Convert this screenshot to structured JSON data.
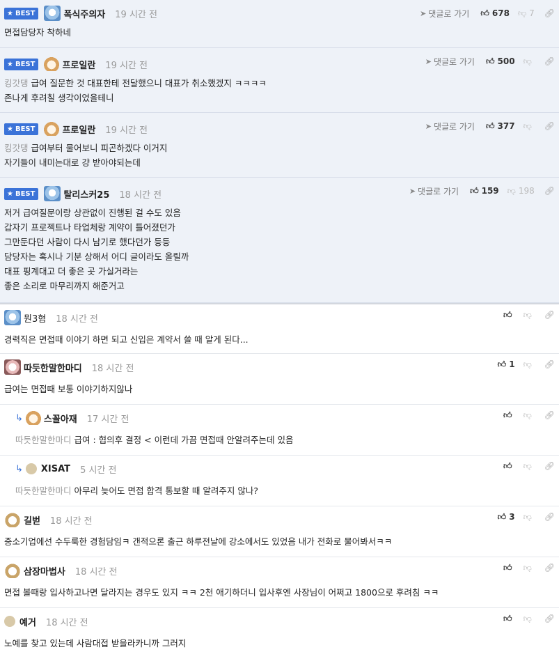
{
  "labels": {
    "best": "BEST",
    "goto": "댓글로 가기"
  },
  "comments": [
    {
      "nick": "폭식주의자",
      "time": "19 시간 전",
      "up": "678",
      "down": "7",
      "lines": [
        "면접담당자 착하네"
      ]
    },
    {
      "nick": "프로일란",
      "time": "19 시간 전",
      "up": "500",
      "down": "",
      "mention": "킹갓댕",
      "lines": [
        "급여 질문한 것 대표한테 전달했으니 대표가 취소했겠지 ㅋㅋㅋㅋ",
        "존나게 후려칠 생각이었을테니"
      ]
    },
    {
      "nick": "프로일란",
      "time": "19 시간 전",
      "up": "377",
      "down": "",
      "mention": "킹갓댕",
      "lines": [
        "급여부터 물어보니 피곤하겠다 이거지",
        "자기들이 내미는대로 걍 받아야되는데"
      ]
    },
    {
      "nick": "탈리스커25",
      "time": "18 시간 전",
      "up": "159",
      "down": "198",
      "lines": [
        "저거 급여질문이랑 상관없이 진행된 걸 수도 있음",
        "갑자기 프로젝트나 타업체랑 계약이 틀어졌던가",
        "그만둔다던 사람이 다시 남기로 했다던가 등등",
        "담당자는 혹시나 기분 상해서 어디 글이라도 올릴까",
        "대표 핑계대고 더 좋은 곳 가실거라는",
        "좋은 소리로 마무리까지 해준거고"
      ]
    },
    {
      "nick": "뭔3혐",
      "time": "18 시간 전",
      "up": "",
      "lines": [
        "경력직은 면접때 이야기 하면 되고 신입은 계약서 쓸 때 알게 된다..."
      ]
    },
    {
      "nick": "따듯한말한마디",
      "time": "18 시간 전",
      "up": "1",
      "lines": [
        "급여는 면접때 보통 이야기하지않나"
      ]
    },
    {
      "nick": "스꼴아재",
      "time": "17 시간 전",
      "up": "",
      "mention": "따듯한말한마디",
      "lines": [
        "급여 : 협의후 결정 < 이런데 가끔 면접때 안알려주는데 있음"
      ]
    },
    {
      "nick": "XISAT",
      "time": "5 시간 전",
      "up": "",
      "mention": "따듯한말한마디",
      "lines": [
        "아무리 늦어도 면접 합격 통보할 때 알려주지 않나?"
      ]
    },
    {
      "nick": "길벋",
      "time": "18 시간 전",
      "up": "3",
      "lines": [
        "중소기업에선 수두룩한 경험담임ㅋ 갠적으론 출근 하루전날에 강소에서도 있었음 내가 전화로 물어봐서ㅋㅋ"
      ]
    },
    {
      "nick": "삼장마법사",
      "time": "18 시간 전",
      "up": "",
      "lines": [
        "면접 볼때랑 입사하고나면 달라지는 경우도 있지 ㅋㅋ 2천 애기하더니 입사후엔 사장님이 어쩌고 1800으로 후려침 ㅋㅋ"
      ]
    },
    {
      "nick": "예거",
      "time": "18 시간 전",
      "up": "",
      "lines": [
        "노예를 찾고 있는데 사람대접 받을라카니까 그러지"
      ]
    }
  ],
  "icons": {
    "thumb_up": "thumb-up-icon",
    "thumb_down": "thumb-down-icon",
    "link": "link-icon",
    "arrow": "send-arrow-icon",
    "reply": "reply-arrow-icon",
    "star": "star-icon"
  },
  "colors": {
    "best_badge": "#3b73d8",
    "best_bg": "#eef2f8"
  }
}
